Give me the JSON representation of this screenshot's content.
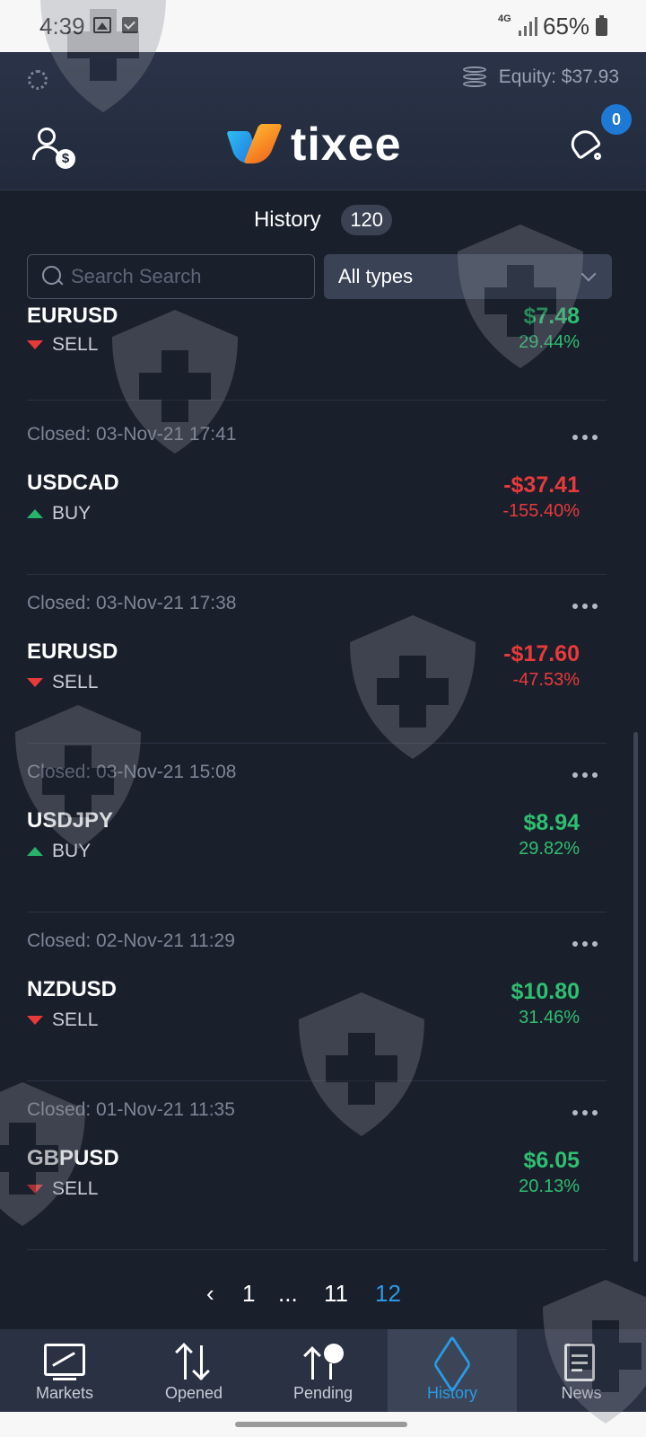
{
  "status_bar": {
    "time": "4:39",
    "network": "4G",
    "battery": "65%"
  },
  "header": {
    "equity": "Equity: $37.93",
    "logo_text": "tixee",
    "notifications_count": "0"
  },
  "history": {
    "title": "History",
    "count": "120"
  },
  "filters": {
    "search_placeholder": "Search Search",
    "type_selected": "All types"
  },
  "trades": [
    {
      "closed": "",
      "symbol": "EURUSD",
      "side": "SELL",
      "direction": "down",
      "pnl": "$7.48",
      "pct": "29.44%",
      "positive": true
    },
    {
      "closed": "Closed: 03-Nov-21 17:41",
      "symbol": "USDCAD",
      "side": "BUY",
      "direction": "up",
      "pnl": "-$37.41",
      "pct": "-155.40%",
      "positive": false
    },
    {
      "closed": "Closed: 03-Nov-21 17:38",
      "symbol": "EURUSD",
      "side": "SELL",
      "direction": "down",
      "pnl": "-$17.60",
      "pct": "-47.53%",
      "positive": false
    },
    {
      "closed": "Closed: 03-Nov-21 15:08",
      "symbol": "USDJPY",
      "side": "BUY",
      "direction": "up",
      "pnl": "$8.94",
      "pct": "29.82%",
      "positive": true
    },
    {
      "closed": "Closed: 02-Nov-21 11:29",
      "symbol": "NZDUSD",
      "side": "SELL",
      "direction": "down",
      "pnl": "$10.80",
      "pct": "31.46%",
      "positive": true
    },
    {
      "closed": "Closed: 01-Nov-21 11:35",
      "symbol": "GBPUSD",
      "side": "SELL",
      "direction": "down",
      "pnl": "$6.05",
      "pct": "20.13%",
      "positive": true
    }
  ],
  "pagination": {
    "prev": "‹",
    "pages": [
      "1",
      "...",
      "11",
      "12"
    ],
    "current": "12"
  },
  "bottom_nav": [
    {
      "label": "Markets",
      "icon": "markets-icon"
    },
    {
      "label": "Opened",
      "icon": "opened-icon"
    },
    {
      "label": "Pending",
      "icon": "pending-icon"
    },
    {
      "label": "History",
      "icon": "history-icon",
      "active": true
    },
    {
      "label": "News",
      "icon": "news-icon"
    }
  ],
  "colors": {
    "positive": "#2fbf71",
    "negative": "#e83a3a",
    "accent": "#2a9ae6",
    "background": "#1a1f2c"
  }
}
